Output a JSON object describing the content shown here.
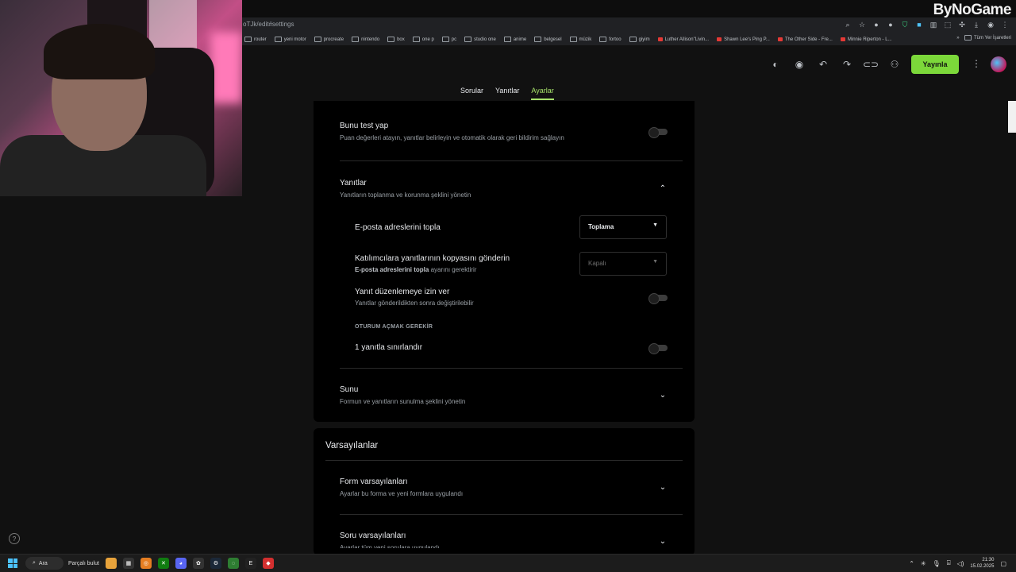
{
  "browser": {
    "url": "oTJk/edit#settings",
    "bookmarks": [
      "router",
      "yeni motor",
      "procreate",
      "nintendo",
      "box",
      "one p",
      "pc",
      "studio one",
      "anime",
      "belgesel",
      "müzik",
      "fortoo",
      "giyim",
      "Luther Allison\"Livin...",
      "Shawn Lee's Ping P...",
      "The Other Side - Fre...",
      "Minnie Riperton - L..."
    ],
    "bookmarks_other": "Tüm Yer İşaretleri"
  },
  "watermark": "ByNoGame",
  "forms": {
    "publish_label": "Yayınla",
    "tabs": [
      "Sorular",
      "Yanıtlar",
      "Ayarlar"
    ],
    "active_tab": "Ayarlar"
  },
  "settings": {
    "quiz": {
      "title": "Bunu test yap",
      "subtitle": "Puan değerleri atayın, yanıtlar belirleyin ve otomatik olarak geri bildirim sağlayın"
    },
    "responses": {
      "title": "Yanıtlar",
      "subtitle": "Yanıtların toplanma ve korunma şeklini yönetin",
      "collect_emails": {
        "label": "E-posta adreslerini topla",
        "value": "Toplama"
      },
      "send_copy": {
        "label": "Katılımcılara yanıtlarının kopyasını gönderin",
        "note_bold": "E-posta adreslerini topla",
        "note_rest": " ayarını gerektirir",
        "value": "Kapalı"
      },
      "allow_edit": {
        "label": "Yanıt düzenlemeye izin ver",
        "subtitle": "Yanıtlar gönderildikten sonra değiştirilebilir"
      },
      "signin_header": "OTURUM AÇMAK GEREKİR",
      "limit_one": {
        "label": "1 yanıtla sınırlandır"
      }
    },
    "presentation": {
      "title": "Sunu",
      "subtitle": "Formun ve yanıtların sunulma şeklini yönetin"
    }
  },
  "defaults": {
    "title": "Varsayılanlar",
    "form_defaults": {
      "title": "Form varsayılanları",
      "subtitle": "Ayarlar bu forma ve yeni formlara uygulandı"
    },
    "question_defaults": {
      "title": "Soru varsayılanları",
      "subtitle": "Ayarlar tüm yeni sorulara uygulandı"
    }
  },
  "taskbar": {
    "search_label": "Ara",
    "weather": "Parçalı bulut",
    "time": "21:30",
    "date": "15.02.2025"
  },
  "colors": {
    "accent": "#7cd83a",
    "active_tab": "#a7e36b",
    "panel_bg": "#000000",
    "page_bg": "#111111"
  }
}
